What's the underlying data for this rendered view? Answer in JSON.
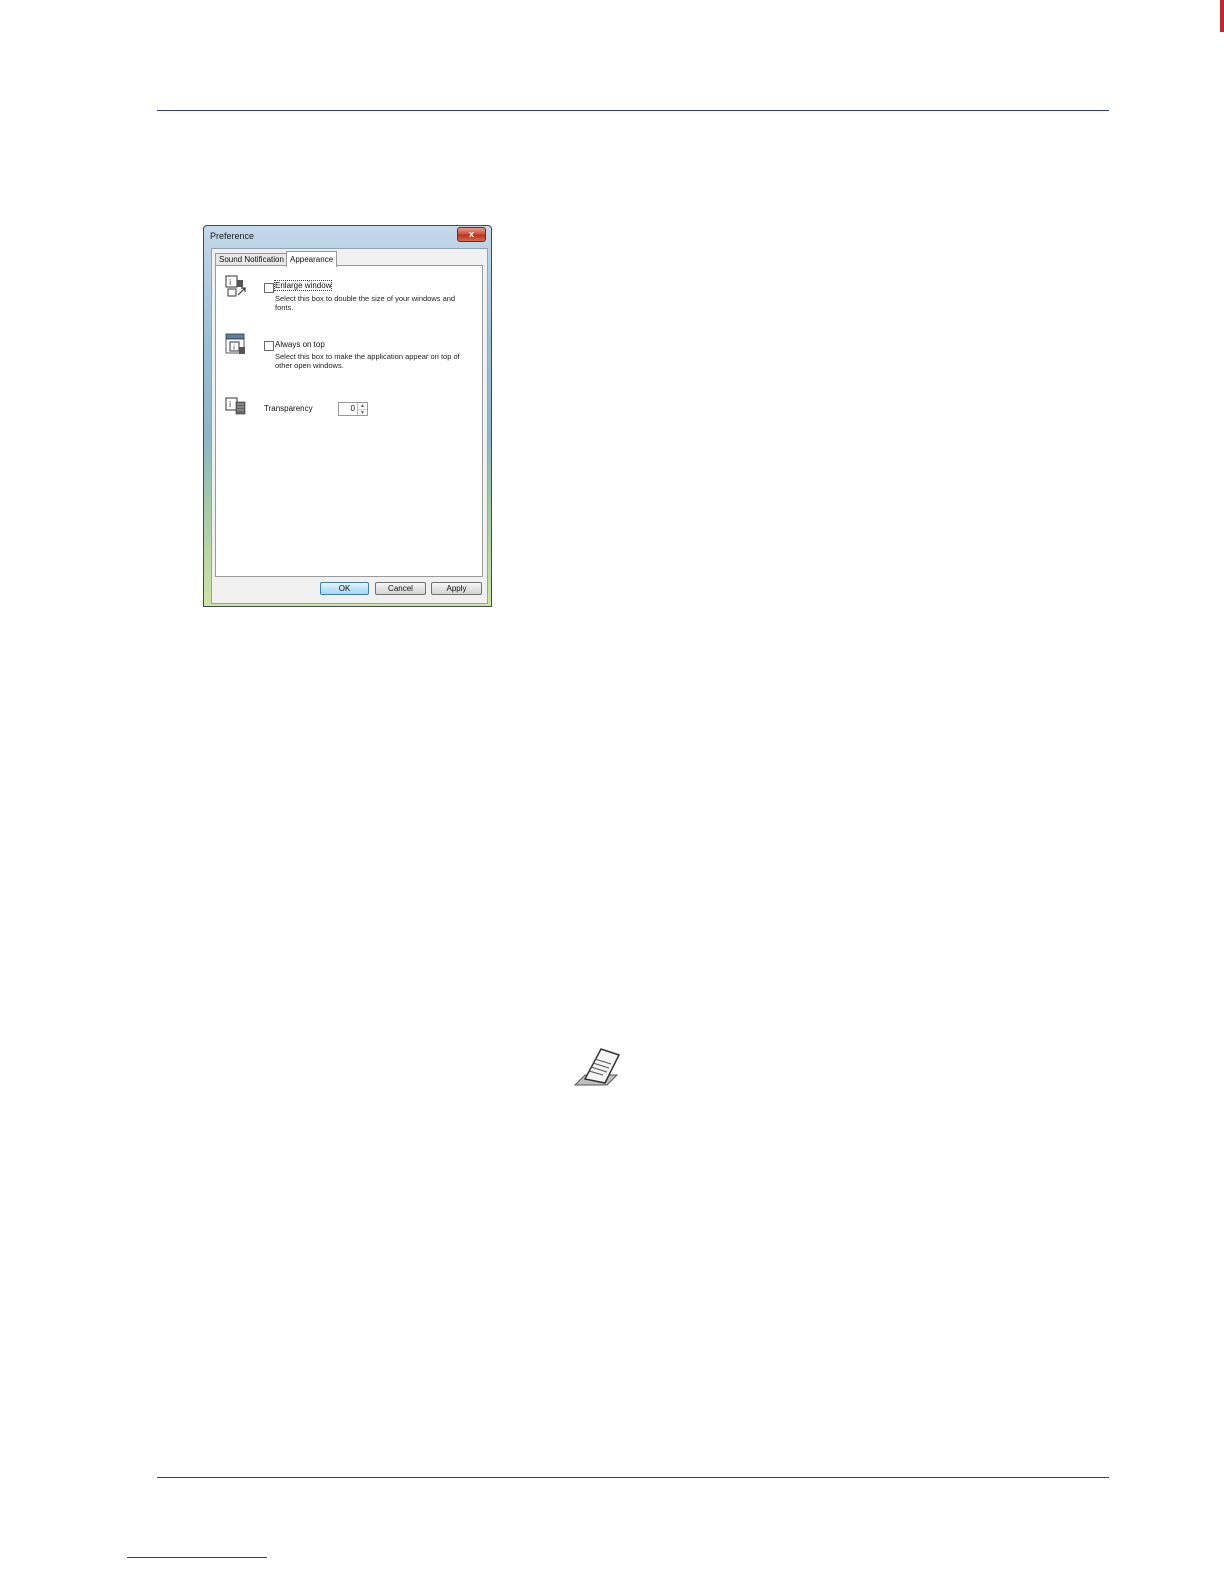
{
  "dialog": {
    "title": "Preference",
    "close_glyph": "x",
    "tabs": [
      {
        "label": "Sound Notification",
        "selected": false
      },
      {
        "label": "Appearance",
        "selected": true
      }
    ],
    "options": [
      {
        "label": "Enlarge window",
        "description": "Select this box to double the size of your windows and fonts.",
        "checked": false,
        "icon": "enlarge-window-icon"
      },
      {
        "label": "Always on top",
        "description": "Select this box to make the application appear on top of other open windows.",
        "checked": false,
        "icon": "always-on-top-icon"
      }
    ],
    "transparency": {
      "label": "Transparency",
      "value": "0",
      "icon": "transparency-icon"
    },
    "buttons": {
      "ok": "OK",
      "cancel": "Cancel",
      "apply": "Apply"
    }
  },
  "note_icon": "note-icon",
  "colors": {
    "rule": "#2c3b8f",
    "edge_mark": "#c0282c"
  }
}
